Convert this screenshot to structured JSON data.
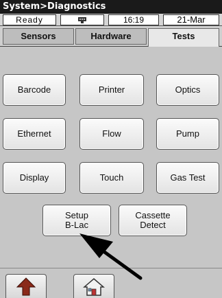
{
  "title": "System>Diagnostics",
  "status": {
    "state": "Ready",
    "time": "16:19",
    "date": "21-Mar",
    "icon": "network-icon"
  },
  "tabs": [
    {
      "label": "Sensors",
      "active": false
    },
    {
      "label": "Hardware",
      "active": false
    },
    {
      "label": "Tests",
      "active": true
    }
  ],
  "buttons": {
    "barcode": "Barcode",
    "printer": "Printer",
    "optics": "Optics",
    "ethernet": "Ethernet",
    "flow": "Flow",
    "pump": "Pump",
    "display": "Display",
    "touch": "Touch",
    "gas_test": "Gas Test",
    "setup_blac": "Setup\nB-Lac",
    "cassette_detect": "Cassette\nDetect"
  },
  "nav": {
    "back_icon": "up-arrow-icon",
    "home_icon": "home-icon"
  },
  "annotation": "pointer-arrow"
}
